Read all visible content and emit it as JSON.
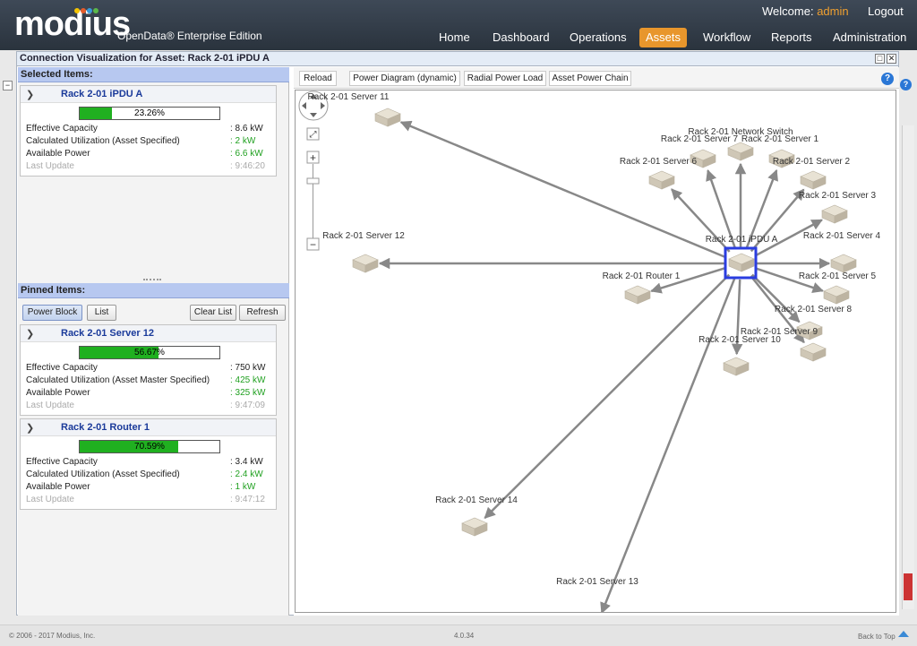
{
  "header": {
    "logo_text": "modius",
    "edition": "OpenData® Enterprise Edition",
    "welcome_label": "Welcome:",
    "user": "admin",
    "logout": "Logout",
    "nav": [
      "Home",
      "Dashboard",
      "Operations",
      "Assets",
      "Workflow",
      "Reports",
      "Administration"
    ],
    "active_nav": "Assets",
    "colors": {
      "bar": "#2d3640",
      "active": "#e8962c",
      "user": "#f0a030"
    }
  },
  "panel": {
    "title": "Connection Visualization for Asset: Rack 2-01 iPDU A",
    "selected_header": "Selected Items:",
    "pinned_header": "Pinned Items:",
    "pinned_buttons": {
      "power_block": "Power Block",
      "list": "List",
      "clear_list": "Clear List",
      "refresh": "Refresh"
    },
    "field_labels": {
      "capacity": "Effective Capacity",
      "available": "Available Power",
      "last_update": "Last Update"
    },
    "selected": {
      "name": "Rack 2-01 iPDU A",
      "utilization": "23.26%",
      "utilization_value": 0.2326,
      "capacity": ": 8.6 kW",
      "util_label": "Calculated Utilization (Asset Specified)",
      "util_value": ": 2 kW",
      "available": ": 6.6 kW",
      "last_update": ": 9:46:20"
    },
    "pinned": [
      {
        "name": "Rack 2-01 Server 12",
        "utilization": "56.67%",
        "utilization_value": 0.5667,
        "capacity": ": 750 kW",
        "util_label": "Calculated Utilization (Asset Master Specified)",
        "util_value": ": 425 kW",
        "available": ": 325 kW",
        "last_update": ": 9:47:09"
      },
      {
        "name": "Rack 2-01 Router 1",
        "utilization": "70.59%",
        "utilization_value": 0.7059,
        "capacity": ": 3.4 kW",
        "util_label": "Calculated Utilization (Asset Specified)",
        "util_value": ": 2.4 kW",
        "available": ": 1 kW",
        "last_update": ": 9:47:12"
      }
    ]
  },
  "toolbar": {
    "reload": "Reload",
    "power_diagram": "Power Diagram (dynamic)",
    "radial_power_load": "Radial Power Load",
    "asset_power_chain": "Asset Power Chain",
    "help": "?"
  },
  "graph": {
    "center": "Rack 2-01 iPDU A",
    "nodes": [
      "Rack 2-01 Server 11",
      "Rack 2-01 Network Switch",
      "Rack 2-01 Server 7",
      "Rack 2-01 Server 1",
      "Rack 2-01 Server 6",
      "Rack 2-01 Server 2",
      "Rack 2-01 Server 3",
      "Rack 2-01 Server 12",
      "Rack 2-01 Server 4",
      "Rack 2-01 Router 1",
      "Rack 2-01 Server 5",
      "Rack 2-01 Server 8",
      "Rack 2-01 Server 9",
      "Rack 2-01 Server 10",
      "Rack 2-01 Server 14",
      "Rack 2-01 Server 13"
    ]
  },
  "footer": {
    "copyright": "© 2006 - 2017 Modius, Inc.",
    "version": "4.0.34",
    "back_to_top": "Back to Top"
  }
}
